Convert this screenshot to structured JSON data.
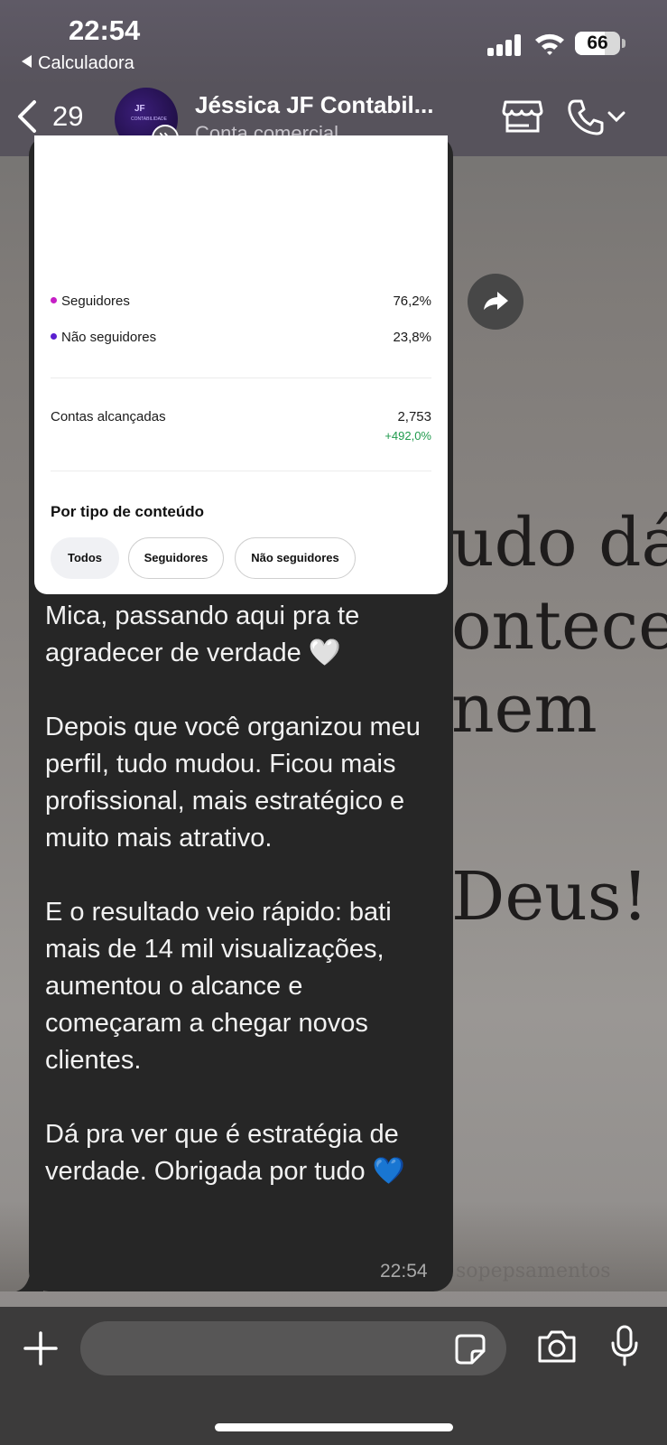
{
  "status_bar": {
    "time": "22:54",
    "back_app_label": "Calculadora",
    "battery_level": "66",
    "battery_fraction": 0.66
  },
  "header": {
    "unread_count": "29",
    "contact_name": "Jéssica JF Contabil...",
    "contact_subtitle": "Conta comercial",
    "avatar_text": "JF",
    "avatar_subtext": "CONTABILIDADE"
  },
  "card": {
    "legend": [
      {
        "label": "Seguidores",
        "value": "76,2%",
        "color": "#c61fc6"
      },
      {
        "label": "Não seguidores",
        "value": "23,8%",
        "color": "#5a1fd0"
      }
    ],
    "reach_label": "Contas alcançadas",
    "reach_value": "2,753",
    "reach_delta": "+492,0%",
    "section_title": "Por tipo de conteúdo",
    "chips": [
      "Todos",
      "Seguidores",
      "Não seguidores"
    ],
    "donut_color": "#d010d0"
  },
  "message": {
    "paragraphs": [
      "Mica, passando aqui pra te agradecer de verdade 🤍",
      "Depois que você organizou meu perfil, tudo mudou. Ficou mais profissional, mais estratégico e muito mais atrativo.",
      "E o resultado veio rápido: bati mais de 14 mil visualizações, aumentou o alcance e começaram a chegar novos clientes.",
      "Dá pra ver que é estratégia de verdade. Obrigada por tudo 💙"
    ],
    "time": "22:54"
  },
  "wallpaper": {
    "lines": [
      "udo dá",
      "ontece.",
      "nem",
      "Deus!"
    ],
    "small_text": "sopepsamentos"
  },
  "input": {
    "placeholder": ""
  },
  "icons": {
    "back": "chevron-left-icon",
    "store": "store-icon",
    "phone": "phone-icon",
    "forward": "forward-arrow-icon",
    "plus": "plus-icon",
    "sticker": "sticker-icon",
    "camera": "camera-icon",
    "mic": "microphone-icon"
  }
}
